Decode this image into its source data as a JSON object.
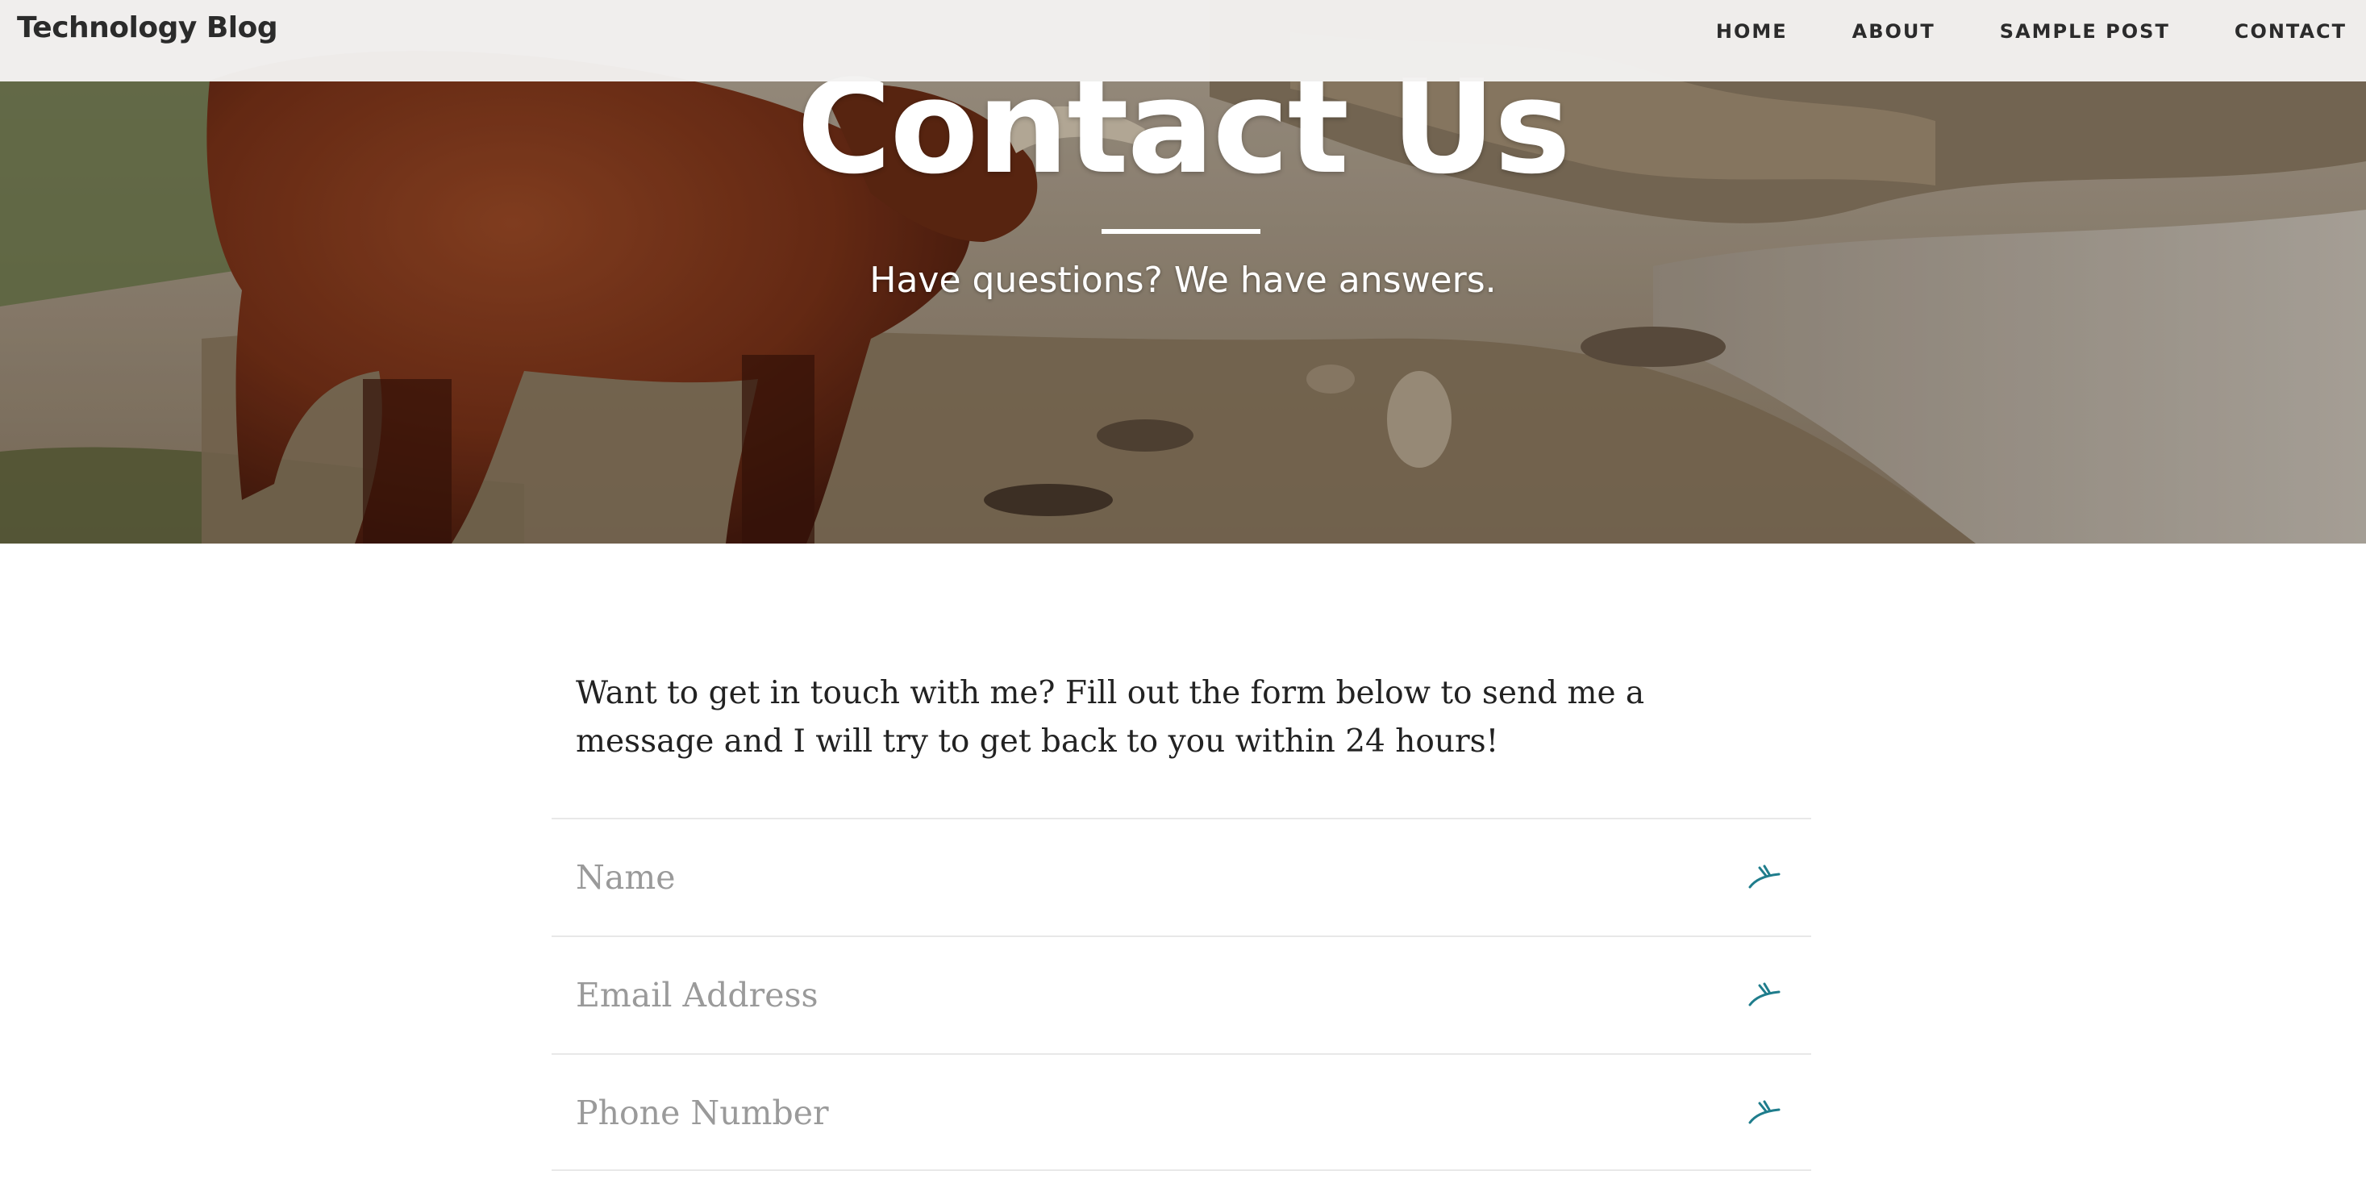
{
  "navbar": {
    "brand": "Technology Blog",
    "links": [
      {
        "label": "HOME"
      },
      {
        "label": "ABOUT"
      },
      {
        "label": "SAMPLE POST"
      },
      {
        "label": "CONTACT"
      }
    ]
  },
  "hero": {
    "title": "Contact Us",
    "subtitle": "Have questions? We have answers.",
    "background_icon": "highland-cow-photo"
  },
  "intro": {
    "text": "Want to get in touch with me? Fill out the form below to send me a message and I will try to get back to you within 24 hours!"
  },
  "form": {
    "fields": [
      {
        "placeholder": "Name",
        "value": "",
        "icon": "form-autofill-icon"
      },
      {
        "placeholder": "Email Address",
        "value": "",
        "icon": "form-autofill-icon"
      },
      {
        "placeholder": "Phone Number",
        "value": "",
        "icon": "form-autofill-icon"
      }
    ]
  },
  "colors": {
    "accent": "#1f7d8c",
    "text": "#222222",
    "placeholder": "#9a9a9a",
    "navbar_bg": "#f3f2f1"
  }
}
